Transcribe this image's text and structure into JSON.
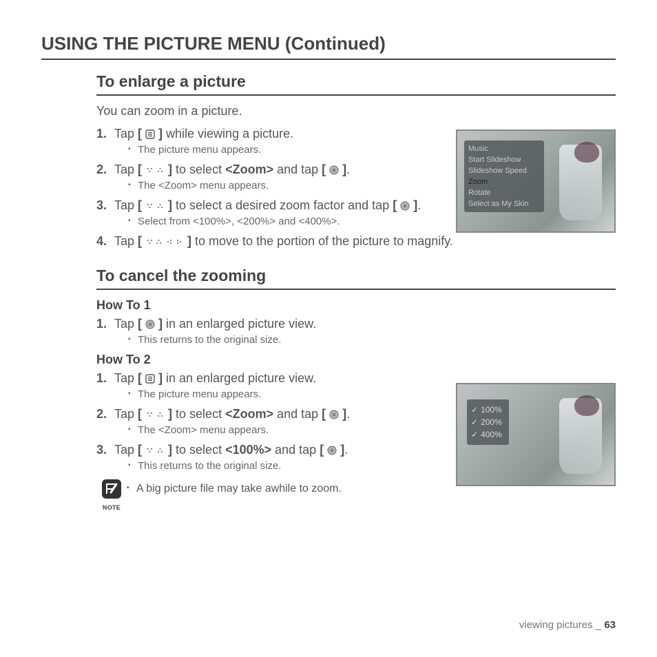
{
  "page_title": "USING THE PICTURE MENU (Continued)",
  "section1": {
    "heading": "To enlarge a picture",
    "intro": "You can zoom in a picture.",
    "steps": [
      {
        "n": "1.",
        "pre": "Tap ",
        "icon": "menu",
        "post": " while viewing a picture.",
        "bullet": "The picture menu appears."
      },
      {
        "n": "2.",
        "pre": "Tap ",
        "icon": "updown",
        "mid": " to select ",
        "bold": "<Zoom>",
        "mid2": " and tap ",
        "icon2": "ok",
        "post": ".",
        "bullet": "The <Zoom> menu appears."
      },
      {
        "n": "3.",
        "pre": "Tap ",
        "icon": "updown",
        "post": " to select a desired zoom factor and tap ",
        "icon2": "ok",
        "post2": ".",
        "bullet": "Select from <100%>, <200%> and <400%>."
      },
      {
        "n": "4.",
        "pre": "Tap ",
        "icon": "4way",
        "post": " to move to the portion of the picture to magnify."
      }
    ],
    "menu_items": [
      "Music",
      "Start Slideshow",
      "Slideshow Speed",
      "Zoom",
      "Rotate",
      "Select as My Skin"
    ],
    "menu_selected_index": 3
  },
  "section2": {
    "heading": "To cancel the zooming",
    "howto1_label": "How To 1",
    "howto1_steps": [
      {
        "n": "1.",
        "pre": "Tap ",
        "icon": "ok",
        "post": " in an enlarged picture view.",
        "bullet": "This returns to the original size."
      }
    ],
    "howto2_label": "How To 2",
    "howto2_steps": [
      {
        "n": "1.",
        "pre": "Tap ",
        "icon": "menu",
        "post": " in an enlarged picture view.",
        "bullet": "The picture menu appears."
      },
      {
        "n": "2.",
        "pre": "Tap ",
        "icon": "updown",
        "mid": " to select ",
        "bold": "<Zoom>",
        "mid2": " and tap ",
        "icon2": "ok",
        "post": ".",
        "bullet": "The <Zoom> menu appears."
      },
      {
        "n": "3.",
        "pre": "Tap ",
        "icon": "updown",
        "mid": " to select ",
        "bold": "<100%>",
        "mid2": " and tap ",
        "icon2": "ok",
        "post": ".",
        "bullet": "This returns to the original size."
      }
    ],
    "zoom_options": [
      "100%",
      "200%",
      "400%"
    ]
  },
  "note": {
    "label": "NOTE",
    "text": "A big picture file may take awhile to zoom."
  },
  "footer": {
    "section": "viewing pictures",
    "sep": " _ ",
    "page": "63"
  },
  "icons": {
    "menu_glyph": "≣",
    "ok_glyph": "●"
  }
}
